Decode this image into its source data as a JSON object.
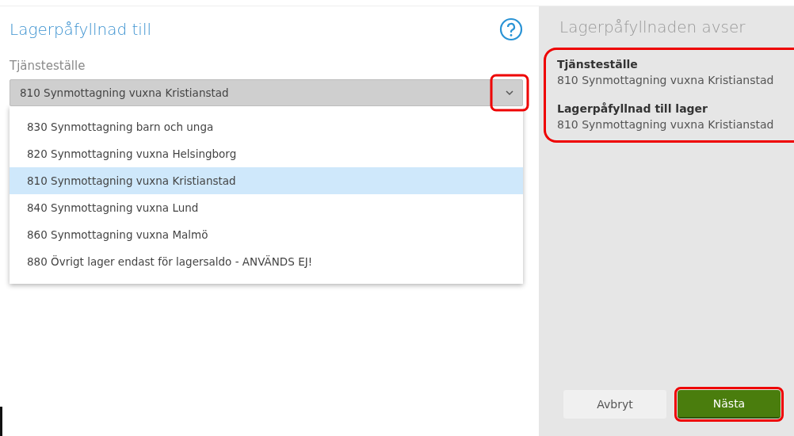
{
  "form": {
    "title": "Lagerpåfyllnad till",
    "field_label": "Tjänsteställe",
    "select": {
      "value": "810 Synmottagning vuxna Kristianstad",
      "expanded": true,
      "toggle_highlighted": true
    },
    "options": [
      {
        "label": "830 Synmottagning barn och unga",
        "selected": false
      },
      {
        "label": "820 Synmottagning vuxna Helsingborg",
        "selected": false
      },
      {
        "label": "810 Synmottagning vuxna Kristianstad",
        "selected": true
      },
      {
        "label": "840 Synmottagning vuxna Lund",
        "selected": false
      },
      {
        "label": "860 Synmottagning vuxna Malmö",
        "selected": false
      },
      {
        "label": "880 Övrigt lager endast för lagersaldo - ANVÄNDS EJ!",
        "selected": false
      }
    ]
  },
  "summary": {
    "title": "Lagerpåfyllnaden avser",
    "highlighted": true,
    "items": [
      {
        "label": "Tjänsteställe",
        "value": "810 Synmottagning vuxna Kristianstad"
      },
      {
        "label": "Lagerpåfyllnad till lager",
        "value": "810 Synmottagning vuxna Kristianstad"
      }
    ]
  },
  "buttons": [
    {
      "label": "Avbryt",
      "kind": "secondary",
      "highlighted": false
    },
    {
      "label": "Nästa",
      "kind": "primary",
      "highlighted": true
    }
  ]
}
